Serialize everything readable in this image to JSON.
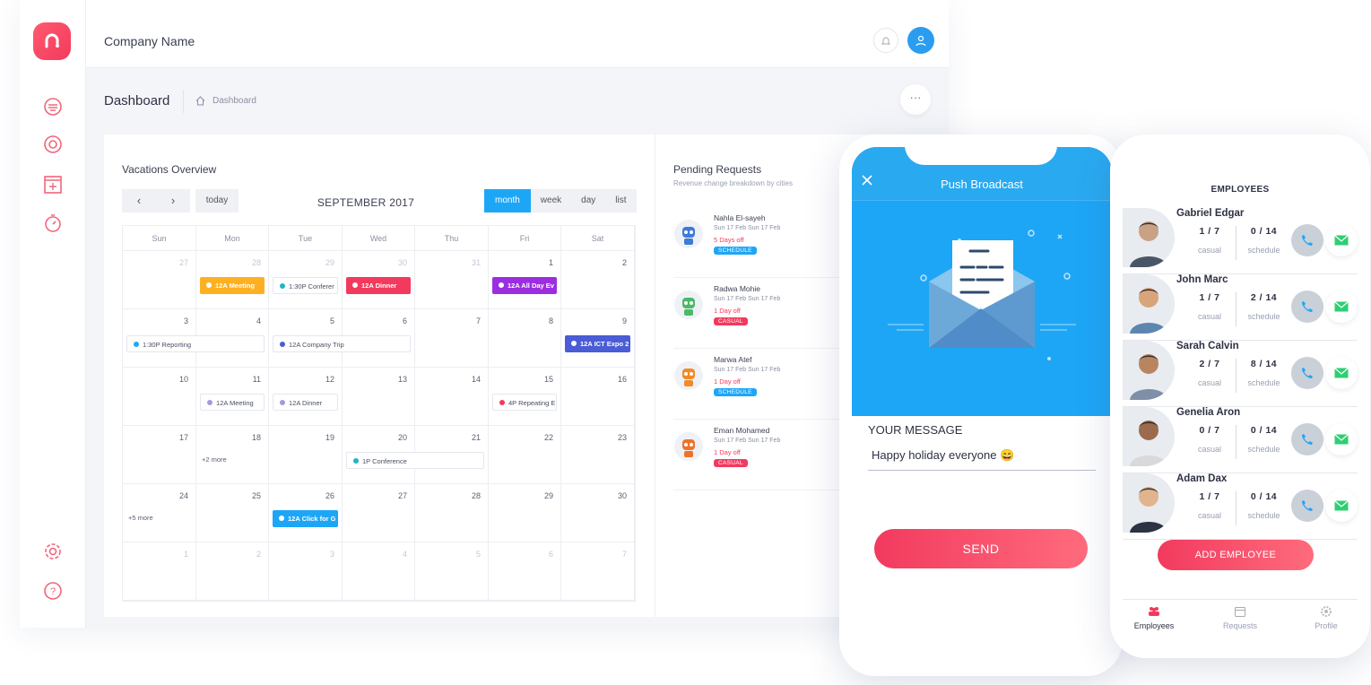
{
  "header": {
    "company": "Company Name"
  },
  "breadcrumb": {
    "title": "Dashboard",
    "crumb": "Dashboard",
    "more": "···"
  },
  "sidebar": {
    "items": [
      "dashboard",
      "support",
      "add",
      "timer",
      "settings",
      "help"
    ]
  },
  "calendar": {
    "title": "Vacations Overview",
    "prev": "‹",
    "next": "›",
    "today": "today",
    "month": "SEPTEMBER 2017",
    "views": [
      "month",
      "week",
      "day",
      "list"
    ],
    "active_view": "month",
    "days": [
      "Sun",
      "Mon",
      "Tue",
      "Wed",
      "Thu",
      "Fri",
      "Sat"
    ],
    "weeks": [
      [
        "27",
        "28",
        "29",
        "30",
        "31",
        "1",
        "2"
      ],
      [
        "3",
        "4",
        "5",
        "6",
        "7",
        "8",
        "9"
      ],
      [
        "10",
        "11",
        "12",
        "13",
        "14",
        "15",
        "16"
      ],
      [
        "17",
        "18",
        "19",
        "20",
        "21",
        "22",
        "23"
      ],
      [
        "24",
        "25",
        "26",
        "27",
        "28",
        "29",
        "30"
      ],
      [
        "1",
        "2",
        "3",
        "4",
        "5",
        "6",
        "7"
      ]
    ],
    "events": [
      {
        "label": "12A Meeting",
        "color": "#fdb021"
      },
      {
        "label": "1:30P Conferer",
        "color": "#1eb6c4"
      },
      {
        "label": "12A Dinner",
        "color": "#f23a5e"
      },
      {
        "label": "12A All Day Ev",
        "color": "#9b2ee0"
      },
      {
        "label": "1:30P Reporting",
        "color": "#1ea6f6"
      },
      {
        "label": "12A Company Trip",
        "color": "#4a5cd6"
      },
      {
        "label": "12A ICT Expo 2",
        "color": "#4a5cd6"
      },
      {
        "label": "12A Meeting",
        "color": "#a59adb"
      },
      {
        "label": "12A Dinner",
        "color": "#a59adb"
      },
      {
        "label": "4P Repeating E",
        "color": "#f23a5e"
      },
      {
        "label": "1P Conference",
        "color": "#1eb6c4"
      },
      {
        "label": "12A Click for G",
        "color": "#1ea6f6"
      }
    ],
    "more_18": "+2 more",
    "more_24": "+5 more"
  },
  "pending": {
    "title": "Pending Requests",
    "subtitle": "Revenue change breakdown by cities",
    "requests": [
      {
        "name": "Nahla El-sayeh",
        "dates": "Sun 17 Feb  Sun 17 Feb",
        "off": "5 Days off",
        "tag": "SCHEDULE",
        "tag_color": "#1ea6f6"
      },
      {
        "name": "Radwa Mohie",
        "dates": "Sun 17 Feb  Sun 17 Feb",
        "off": "1 Day off",
        "tag": "CASUAL",
        "tag_color": "#f23a5e"
      },
      {
        "name": "Marwa Atef",
        "dates": "Sun 17 Feb  Sun 17 Feb",
        "off": "1 Day off",
        "tag": "SCHEDULE",
        "tag_color": "#1ea6f6"
      },
      {
        "name": "Eman Mohamed",
        "dates": "Sun 17 Feb  Sun 17 Feb",
        "off": "1 Day off",
        "tag": "CASUAL",
        "tag_color": "#f23a5e"
      }
    ]
  },
  "broadcast": {
    "title": "Push Broadcast",
    "message_label": "YOUR MESSAGE",
    "message_value": "Happy holiday everyone 😄",
    "send": "SEND"
  },
  "employees": {
    "title": "EMPLOYEES",
    "casual_label": "casual",
    "schedule_label": "schedule",
    "list": [
      {
        "name": "Gabriel Edgar",
        "casual": "1 / 7",
        "schedule": "0 / 14"
      },
      {
        "name": "John Marc",
        "casual": "1 / 7",
        "schedule": "2 / 14"
      },
      {
        "name": "Sarah Calvin",
        "casual": "2 / 7",
        "schedule": "8 / 14"
      },
      {
        "name": "Genelia Aron",
        "casual": "0 / 7",
        "schedule": "0 / 14"
      },
      {
        "name": "Adam Dax",
        "casual": "1 / 7",
        "schedule": "0 / 14"
      }
    ],
    "add": "ADD EMPLOYEE",
    "tabs": [
      "Employees",
      "Requests",
      "Profile"
    ]
  },
  "colors": {
    "brand": "#f23a5e",
    "accent": "#1ea6f6"
  }
}
